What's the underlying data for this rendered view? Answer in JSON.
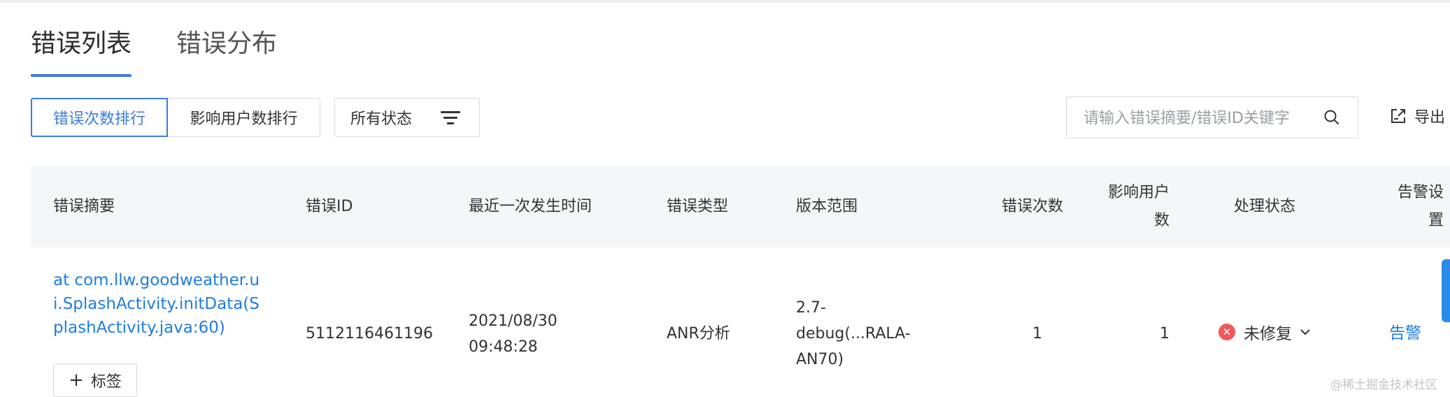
{
  "tabs": [
    {
      "label": "错误列表",
      "active": true
    },
    {
      "label": "错误分布",
      "active": false
    }
  ],
  "sort_buttons": [
    {
      "label": "错误次数排行",
      "active": true
    },
    {
      "label": "影响用户数排行",
      "active": false
    }
  ],
  "status_filter": {
    "selected": "所有状态",
    "icon": "filter-icon"
  },
  "search": {
    "placeholder": "请输入错误摘要/错误ID关键字",
    "value": "",
    "icon": "search-icon"
  },
  "export": {
    "label": "导出",
    "icon": "export-icon"
  },
  "table": {
    "headers": {
      "summary": "错误摘要",
      "error_id": "错误ID",
      "last_time": "最近一次发生时间",
      "type": "错误类型",
      "version": "版本范围",
      "count": "错误次数",
      "users_line1": "影响用户",
      "users_line2": "数",
      "status": "处理状态",
      "alarm_line1": "告警设",
      "alarm_line2": "置"
    },
    "rows": [
      {
        "summary": "at com.llw.goodweather.ui.SplashActivity.initData(SplashActivity.java:60)",
        "tag_button": "标签",
        "error_id": "5112116461196",
        "date": "2021/08/30",
        "time": "09:48:28",
        "type": "ANR分析",
        "version_line1": "2.7-",
        "version_line2": "debug(...RALA-",
        "version_line3": "AN70)",
        "count": "1",
        "users": "1",
        "status": "未修复",
        "alarm": "告警"
      }
    ]
  },
  "watermark": "@稀土掘金技术社区",
  "colors": {
    "accent": "#3b7ddd",
    "link": "#1e7ee0",
    "error": "#f0595a",
    "header_bg": "#f5f6f8",
    "border": "#d6d9de"
  }
}
